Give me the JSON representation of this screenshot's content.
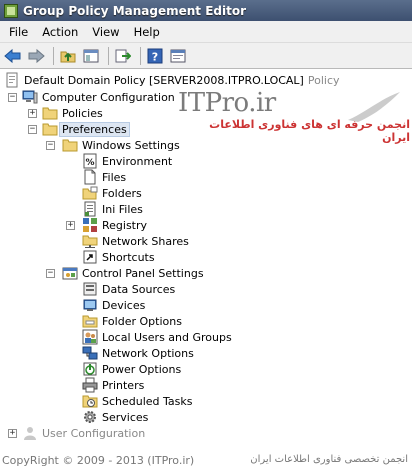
{
  "window": {
    "title": "Group Policy Management Editor"
  },
  "menu": [
    "File",
    "Action",
    "View",
    "Help"
  ],
  "watermark": {
    "title": "ITPro.ir",
    "subtitle": "انجمن حرفه ای های فناوری اطلاعات ایران"
  },
  "footer": {
    "left": "CopyRight © 2009 - 2013 (ITPro.ir)",
    "right": "انجمن تخصصی فناوری اطلاعات ایران"
  },
  "tree": {
    "root_label": "Default Domain Policy [SERVER2008.ITPRO.LOCAL]",
    "root_suffix": "Policy",
    "computer_config": "Computer Configuration",
    "policies": "Policies",
    "preferences": "Preferences",
    "windows_settings": "Windows Settings",
    "ws_items": [
      "Environment",
      "Files",
      "Folders",
      "Ini Files",
      "Registry",
      "Network Shares",
      "Shortcuts"
    ],
    "control_panel_settings": "Control Panel Settings",
    "cp_items": [
      "Data Sources",
      "Devices",
      "Folder Options",
      "Local Users and Groups",
      "Network Options",
      "Power Options",
      "Printers",
      "Scheduled Tasks",
      "Services"
    ],
    "user_config": "User Configuration"
  }
}
